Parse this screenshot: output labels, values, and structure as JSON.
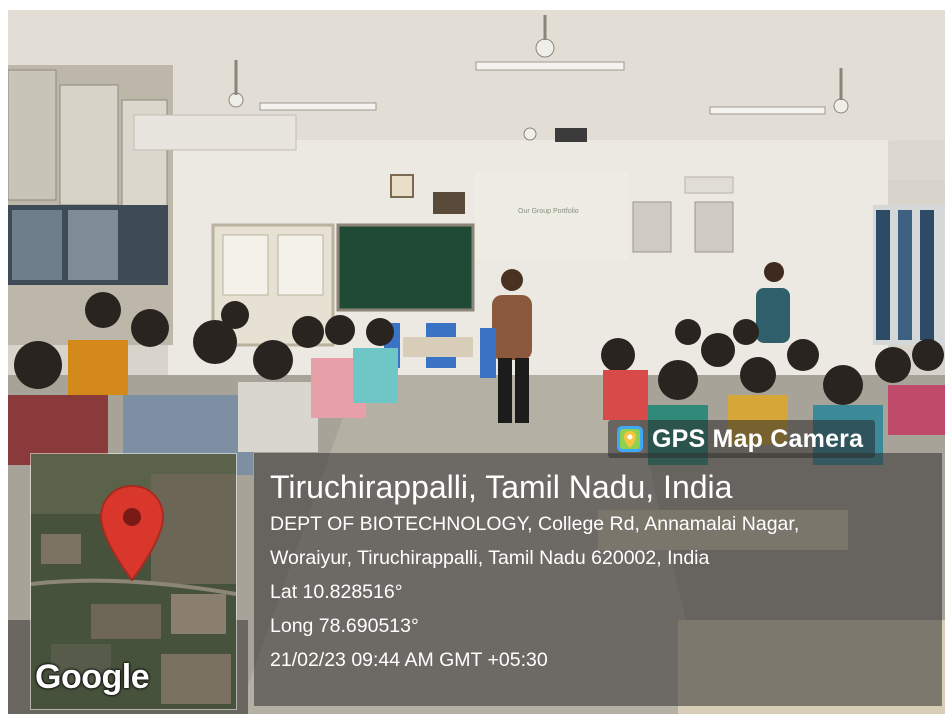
{
  "badge": {
    "label": "GPS Map Camera",
    "icon": "gps-map-camera-logo-icon"
  },
  "map": {
    "attribution": "Google",
    "icon": "location-pin-icon"
  },
  "location": {
    "title": "Tiruchirappalli, Tamil Nadu, India",
    "address_line1": "DEPT OF BIOTECHNOLOGY, College Rd, Annamalai Nagar,",
    "address_line2": "Woraiyur, Tiruchirappalli, Tamil Nadu 620002, India",
    "lat": "Lat 10.828516°",
    "long": "Long 78.690513°",
    "timestamp": "21/02/23 09:44 AM GMT +05:30"
  },
  "projector_slide_text": "Our Group Portfolio",
  "colors": {
    "chalkboard": "#1f4a36",
    "overlay": "rgba(50,50,50,0.55)",
    "pin": "#d9372b"
  }
}
